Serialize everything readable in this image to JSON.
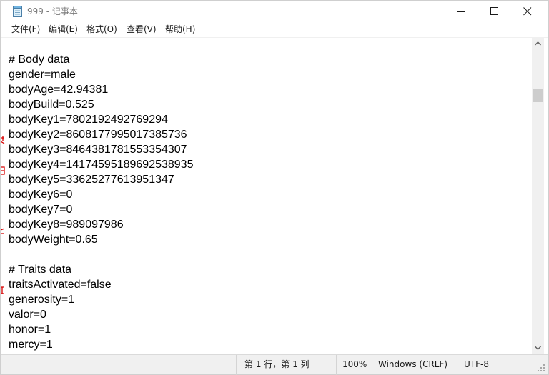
{
  "window": {
    "title": "999 - 记事本"
  },
  "menu": [
    "文件(F)",
    "编辑(E)",
    "格式(O)",
    "查看(V)",
    "帮助(H)"
  ],
  "editor": {
    "lines": [
      "# Body data",
      "gender=male",
      "bodyAge=42.94381",
      "bodyBuild=0.525",
      "bodyKey1=7802192492769294",
      "bodyKey2=8608177995017385736",
      "bodyKey3=8464381781553354307",
      "bodyKey4=14174595189692538935",
      "bodyKey5=33625277613951347",
      "bodyKey6=0",
      "bodyKey7=0",
      "bodyKey8=989097986",
      "bodyWeight=0.65",
      "",
      "# Traits data",
      "traitsActivated=false",
      "generosity=1",
      "valor=0",
      "honor=1",
      "mercy=1"
    ]
  },
  "status": {
    "position": "第 1 行，第 1 列",
    "zoom": "100%",
    "line_ending": "Windows (CRLF)",
    "encoding": "UTF-8"
  },
  "icons": {
    "app": "notepad-icon",
    "minimize": "minimize-icon",
    "maximize": "maximize-icon",
    "close": "close-icon",
    "scroll_up": "chevron-up-icon",
    "scroll_down": "chevron-down-icon",
    "resize": "resize-grip-icon"
  },
  "colors": {
    "accent_mark": "#d80000",
    "title_text": "#7a7a7a",
    "chrome": "#f0f0f0"
  }
}
